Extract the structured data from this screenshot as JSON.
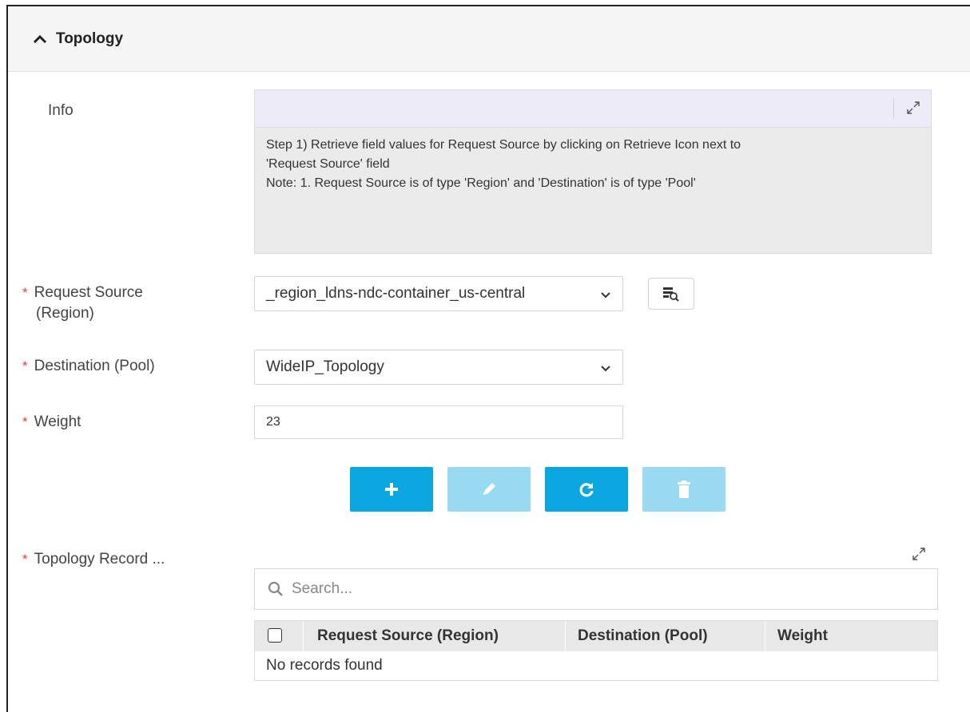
{
  "section": {
    "title": "Topology",
    "icon": "chevron-up-icon"
  },
  "info": {
    "label": "Info",
    "lines": [
      "Step 1) Retrieve field values for Request Source by clicking on Retrieve Icon next to",
      "'Request Source' field",
      "Note: 1. Request Source is of type 'Region' and 'Destination' is of type 'Pool'"
    ]
  },
  "form": {
    "request_source": {
      "label_line1": "Request Source",
      "label_line2": "(Region)",
      "value": "_region_ldns-ndc-container_us-central"
    },
    "destination": {
      "label": "Destination (Pool)",
      "value": "WideIP_Topology"
    },
    "weight": {
      "label": "Weight",
      "value": "23"
    },
    "required_mark": "*"
  },
  "grid": {
    "label": "Topology Record ...",
    "search_placeholder": "Search...",
    "columns": [
      "Request Source (Region)",
      "Destination (Pool)",
      "Weight"
    ],
    "empty_message": "No records found"
  },
  "colors": {
    "primary_button": "#0aa6e0",
    "disabled_button": "#99daf3",
    "required": "#e04040",
    "info_toolbar": "#ecebf7"
  }
}
